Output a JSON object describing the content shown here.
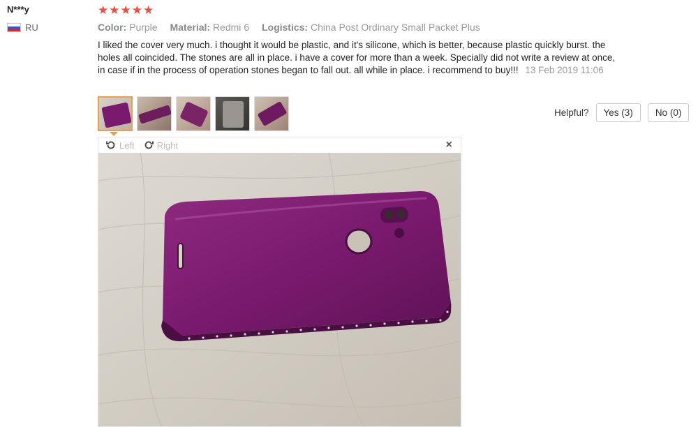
{
  "reviewer": {
    "name": "N***y",
    "country": "RU"
  },
  "rating": {
    "stars": 5,
    "display": "★★★★★",
    "color": "#f04d3d"
  },
  "attributes": [
    {
      "key": "Color:",
      "value": "Purple"
    },
    {
      "key": "Material:",
      "value": "Redmi 6"
    },
    {
      "key": "Logistics:",
      "value": "China Post Ordinary Small Packet Plus"
    }
  ],
  "review": {
    "text": "I liked the cover very much. i thought it would be plastic, and it's silicone, which is better, because plastic quickly burst. the holes all coincided. The stones are all in place. i have a cover for more than a week. Specially did not write a review at once, in case if in the process of operation stones began to fall out. all while in place. i recommend to buy!!!",
    "date": "13 Feb 2019 11:06"
  },
  "thumbnails": [
    {
      "name": "photo-1",
      "active": true
    },
    {
      "name": "photo-2",
      "active": false
    },
    {
      "name": "photo-3",
      "active": false
    },
    {
      "name": "photo-4",
      "active": false
    },
    {
      "name": "photo-5",
      "active": false
    }
  ],
  "helpful": {
    "label": "Helpful?",
    "yes": "Yes (3)",
    "no": "No (0)"
  },
  "viewer": {
    "rotate_left": "Left",
    "rotate_right": "Right",
    "close": "×"
  },
  "colors": {
    "accent": "#f29b47",
    "case_purple": "#7a1a6e"
  }
}
